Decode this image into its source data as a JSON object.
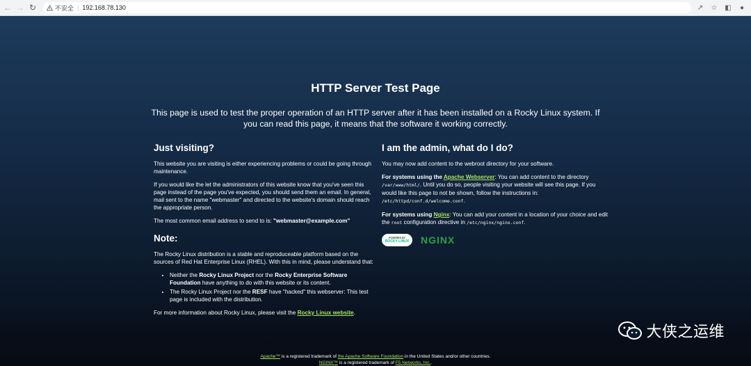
{
  "browser": {
    "security_label": "不安全",
    "url": "192.168.78.130"
  },
  "page": {
    "title": "HTTP Server Test Page",
    "lead": "This page is used to test the proper operation of an HTTP server after it has been installed on a Rocky Linux system. If you can read this page, it means that the software it working correctly.",
    "left": {
      "heading": "Just visiting?",
      "p1": "This website you are visiting is either experiencing problems or could be going through maintenance.",
      "p2": "If you would like the let the administrators of this website know that you've seen this page instead of the page you've expected, you should send them an email. In general, mail sent to the name \"webmaster\" and directed to the website's domain should reach the appropriate person.",
      "p3_prefix": "The most common email address to send to is: ",
      "p3_email": "\"webmaster@example.com\"",
      "note_heading": "Note:",
      "note_p": "The Rocky Linux distribution is a stable and reproduceable platform based on the sources of Red Hat Enterprise Linux (RHEL). With this in mind, please understand that:",
      "bullet1_a": "Neither the ",
      "bullet1_b": "Rocky Linux Project",
      "bullet1_c": " nor the ",
      "bullet1_d": "Rocky Enterprise Software Foundation",
      "bullet1_e": " have anything to do with this website or its content.",
      "bullet2_a": "The Rocky Linux Project nor the ",
      "bullet2_b": "RESF",
      "bullet2_c": " have \"hacked\" this webserver: This test page is included with the distribution.",
      "more_prefix": "For more information about Rocky Linux, please visit the ",
      "more_link": "Rocky Linux website",
      "more_suffix": "."
    },
    "right": {
      "heading": "I am the admin, what do I do?",
      "p1": "You may now add content to the webroot directory for your software.",
      "apache_prefix": "For systems using the ",
      "apache_link": "Apache Webserver",
      "apache_text1": ": You can add content to the directory ",
      "apache_dir": "/var/www/html/",
      "apache_text2": ". Until you do so, people visiting your website will see this page. If you would like this page to not be shown, follow the instructions in: ",
      "apache_conf": "/etc/httpd/conf.d/welcome.conf",
      "apache_end": ".",
      "nginx_prefix": "For systems using ",
      "nginx_link": "Nginx",
      "nginx_text1": ": You can add your content in a location of your choice and edit the ",
      "nginx_root": "root",
      "nginx_text2": " configuration directive in ",
      "nginx_conf": "/etc/nginx/nginx.conf",
      "nginx_end": ".",
      "rocky_logo_small": "POWERED BY",
      "rocky_logo_text": "ROCKY LINUX",
      "nginx_logo_text": "NGINX"
    },
    "footer": {
      "line1_link1": "Apache™",
      "line1_text1": " is a registered trademark of ",
      "line1_link2": "the Apache Software Foundation",
      "line1_text2": " in the United States and/or other countries.",
      "line2_link1": "NGINX™",
      "line2_text1": " is a registered trademark of ",
      "line2_link2": "F5 Networks, Inc.",
      "line2_text2": "."
    }
  },
  "watermark": {
    "name": "大侠之运维"
  }
}
